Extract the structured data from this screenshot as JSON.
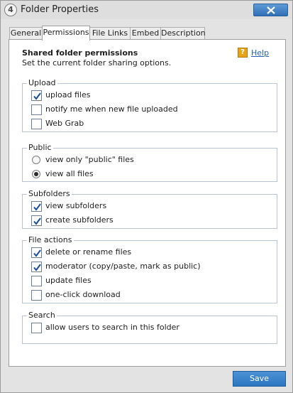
{
  "window": {
    "app_icon_glyph": "4",
    "title": "Folder Properties"
  },
  "tabs": [
    {
      "label": "General"
    },
    {
      "label": "Permissions"
    },
    {
      "label": "File Links"
    },
    {
      "label": "Embed"
    },
    {
      "label": "Description"
    }
  ],
  "active_tab": "Permissions",
  "panel": {
    "heading": "Shared folder permissions",
    "subheading": "Set the current folder sharing options.",
    "help_icon_glyph": "?",
    "help_label": "Help"
  },
  "groups": {
    "upload": {
      "label": "Upload",
      "options": [
        {
          "label": "upload files",
          "checked": true
        },
        {
          "label": "notify me when new file uploaded",
          "checked": false
        },
        {
          "label": "Web Grab",
          "checked": false
        }
      ]
    },
    "public": {
      "label": "Public",
      "options": [
        {
          "label": "view only \"public\" files",
          "selected": false
        },
        {
          "label": "view all files",
          "selected": true
        }
      ]
    },
    "subfolders": {
      "label": "Subfolders",
      "options": [
        {
          "label": "view subfolders",
          "checked": true
        },
        {
          "label": "create subfolders",
          "checked": true
        }
      ]
    },
    "file_actions": {
      "label": "File actions",
      "options": [
        {
          "label": "delete or rename files",
          "checked": true
        },
        {
          "label": "moderator (copy/paste, mark as public)",
          "checked": true
        },
        {
          "label": "update files",
          "checked": false
        },
        {
          "label": "one-click download",
          "checked": false
        }
      ]
    },
    "search": {
      "label": "Search",
      "options": [
        {
          "label": "allow users to search in this folder",
          "checked": false
        }
      ]
    }
  },
  "footer": {
    "save_label": "Save"
  },
  "colors": {
    "accent_blue": "#2b76c1",
    "close_button": "#3f7fc4",
    "help_icon": "#e8a417",
    "checkmark": "#1c4f9a",
    "group_border": "#b8c4d2"
  },
  "icons": {
    "app": "app-logo-icon",
    "close": "close-icon",
    "help": "help-icon",
    "check": "checkmark-icon"
  }
}
